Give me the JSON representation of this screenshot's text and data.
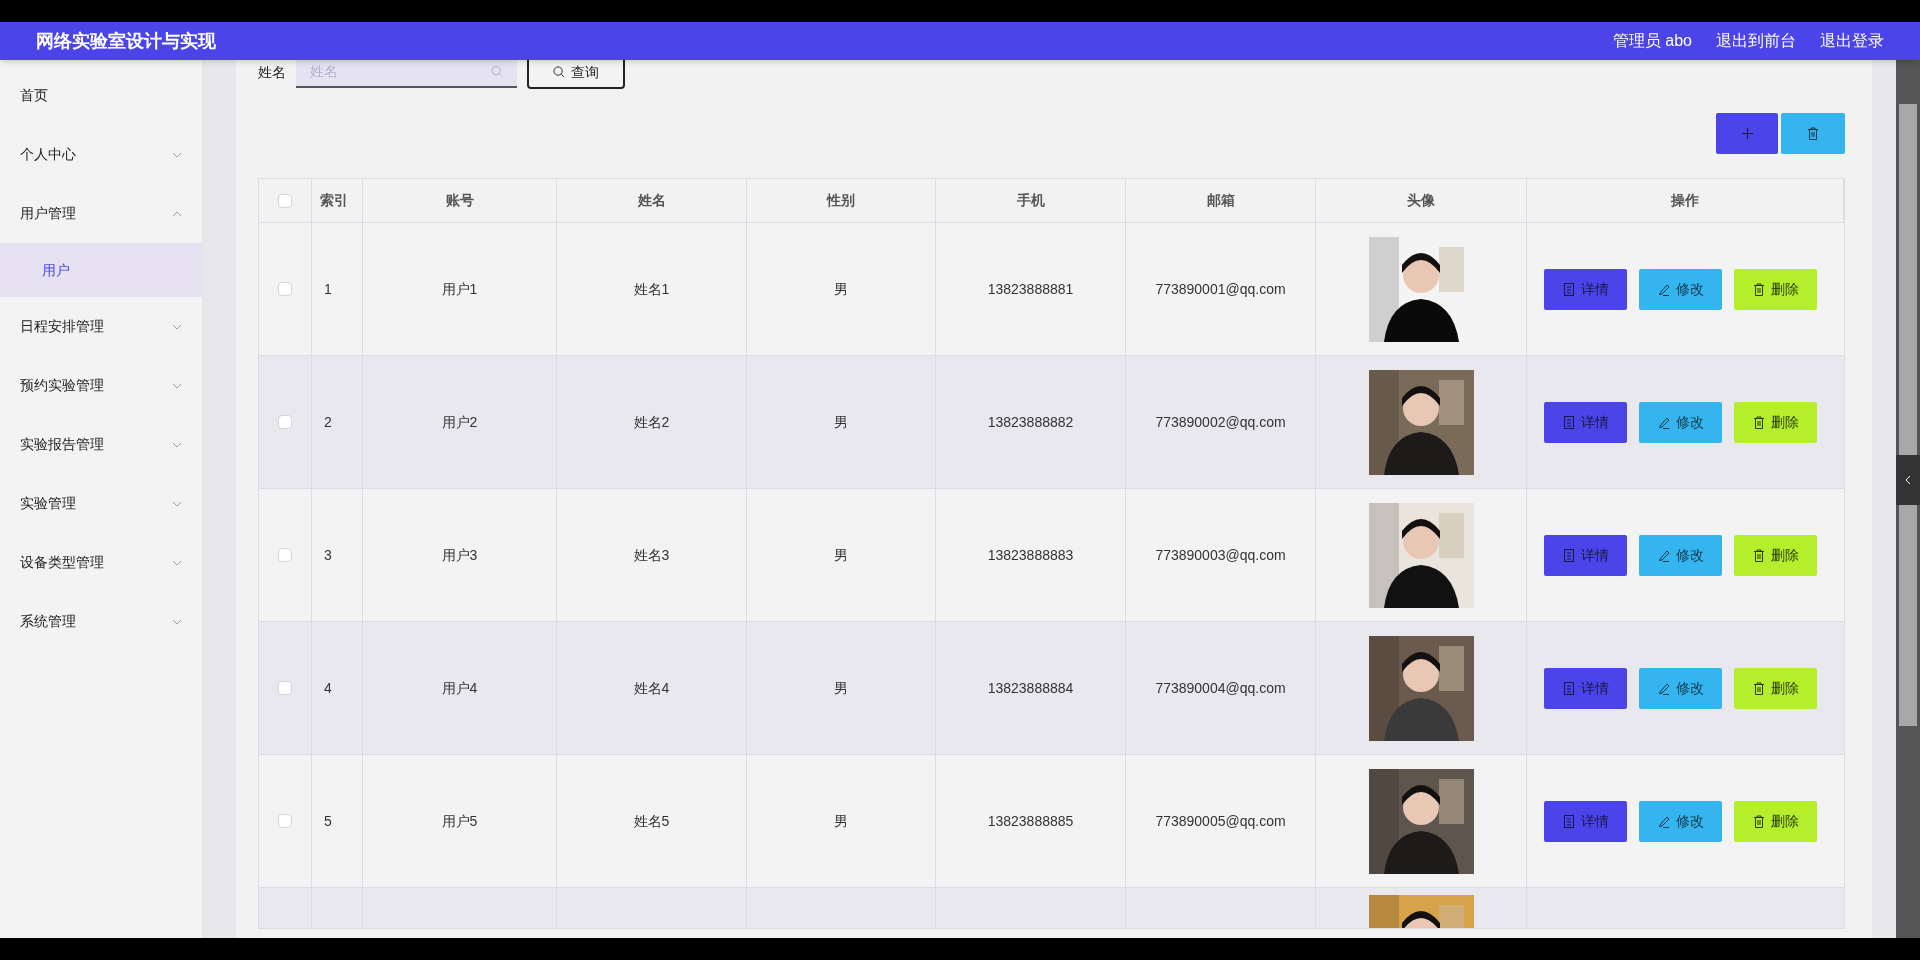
{
  "header": {
    "title": "网络实验室设计与实现",
    "user": "管理员 abo",
    "links": [
      "退出到前台",
      "退出登录"
    ]
  },
  "sidebar": {
    "items": [
      {
        "label": "首页",
        "kind": "link",
        "selected": false
      },
      {
        "label": "个人中心",
        "kind": "group",
        "expanded": false,
        "selected": false
      },
      {
        "label": "用户管理",
        "kind": "group",
        "expanded": true,
        "selected": false,
        "children": [
          {
            "label": "用户",
            "selected": true
          }
        ]
      },
      {
        "label": "日程安排管理",
        "kind": "group",
        "expanded": false,
        "selected": false
      },
      {
        "label": "预约实验管理",
        "kind": "group",
        "expanded": false,
        "selected": false
      },
      {
        "label": "实验报告管理",
        "kind": "group",
        "expanded": false,
        "selected": false
      },
      {
        "label": "实验管理",
        "kind": "group",
        "expanded": false,
        "selected": false
      },
      {
        "label": "设备类型管理",
        "kind": "group",
        "expanded": false,
        "selected": false
      },
      {
        "label": "系统管理",
        "kind": "group",
        "expanded": false,
        "selected": false
      }
    ]
  },
  "search": {
    "label": "姓名",
    "placeholder": "姓名",
    "button": "查询"
  },
  "table": {
    "header_checked": false,
    "columns": [
      "索引",
      "账号",
      "姓名",
      "性别",
      "手机",
      "邮箱",
      "头像",
      "操作"
    ],
    "rows": [
      {
        "kind": "full",
        "checked": false,
        "index": "1",
        "account": "用户1",
        "name": "姓名1",
        "gender": "男",
        "phone": "13823888881",
        "email": "773890001@qq.com",
        "actions": [
          "详情",
          "修改",
          "删除"
        ]
      },
      {
        "kind": "full",
        "checked": false,
        "index": "2",
        "account": "用户2",
        "name": "姓名2",
        "gender": "男",
        "phone": "13823888882",
        "email": "773890002@qq.com",
        "actions": [
          "详情",
          "修改",
          "删除"
        ]
      },
      {
        "kind": "full",
        "checked": false,
        "index": "3",
        "account": "用户3",
        "name": "姓名3",
        "gender": "男",
        "phone": "13823888883",
        "email": "773890003@qq.com",
        "actions": [
          "详情",
          "修改",
          "删除"
        ]
      },
      {
        "kind": "full",
        "checked": false,
        "index": "4",
        "account": "用户4",
        "name": "姓名4",
        "gender": "男",
        "phone": "13823888884",
        "email": "773890004@qq.com",
        "actions": [
          "详情",
          "修改",
          "删除"
        ]
      },
      {
        "kind": "full",
        "checked": false,
        "index": "5",
        "account": "用户5",
        "name": "姓名5",
        "gender": "男",
        "phone": "13823888885",
        "email": "773890005@qq.com",
        "actions": [
          "详情",
          "修改",
          "删除"
        ]
      },
      {
        "kind": "cut"
      }
    ]
  }
}
